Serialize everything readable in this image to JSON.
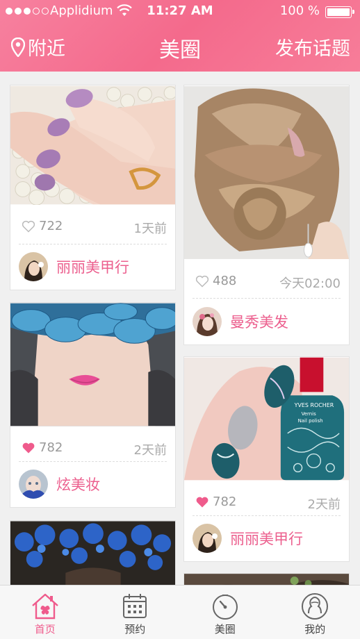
{
  "status_bar": {
    "carrier": "Applidium",
    "time": "11:27 AM",
    "battery": "100 %"
  },
  "nav": {
    "location_label": "附近",
    "title": "美圈",
    "post_label": "发布话题"
  },
  "posts": [
    {
      "likes": "722",
      "ago": "1天前",
      "author": "丽丽美甲行",
      "liked": false
    },
    {
      "likes": "488",
      "ago": "今天02:00",
      "author": "曼秀美发",
      "liked": false
    },
    {
      "likes": "782",
      "ago": "2天前",
      "author": "炫美妆",
      "liked": true
    },
    {
      "likes": "782",
      "ago": "2天前",
      "author": "丽丽美甲行",
      "liked": true
    }
  ],
  "tabs": [
    {
      "label": "首页",
      "icon": "home-icon",
      "active": true
    },
    {
      "label": "预约",
      "icon": "calendar-icon",
      "active": false
    },
    {
      "label": "美圈",
      "icon": "circle-clock-icon",
      "active": false
    },
    {
      "label": "我的",
      "icon": "user-icon",
      "active": false
    }
  ],
  "colors": {
    "accent": "#ef5b8c",
    "header": "#f46a8c",
    "heart": "#ef5b8c"
  }
}
